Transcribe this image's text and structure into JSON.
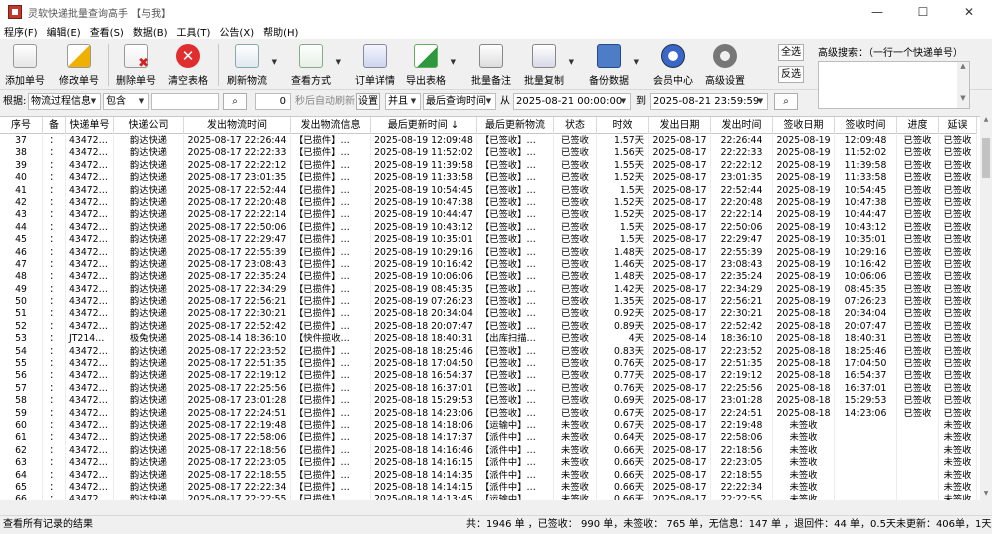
{
  "window": {
    "title": "灵软快递批量查询高手 【与我】",
    "minimize": "—",
    "maximize": "☐",
    "close": "✕"
  },
  "menu": [
    "程序(F)",
    "编辑(E)",
    "查看(S)",
    "数据(B)",
    "工具(T)",
    "公告(X)",
    "帮助(H)"
  ],
  "toolbar": {
    "add": "添加单号",
    "edit": "修改单号",
    "delete": "删除单号",
    "clear": "清空表格",
    "refresh": "刷新物流",
    "view_mode": "查看方式",
    "details": "订单详情",
    "export": "导出表格",
    "batch_note": "批量备注",
    "batch_copy": "批量复制",
    "backup": "备份数据",
    "member": "会员中心",
    "advanced_settings": "高级设置",
    "select_all": "全选",
    "invert": "反选",
    "advanced_search_label": "高级搜索：（一行一个快递单号）"
  },
  "filter": {
    "label": "根据:",
    "field": "物流过程信息",
    "match": "包含",
    "search_text": "",
    "count_value": "0",
    "auto_refresh": "秒后自动刷新",
    "settings": "设置",
    "logic": "并且",
    "time_field": "最后查询时间",
    "from_label": "从",
    "from_date": "2025-08-21 00:00:00",
    "to_label": "到",
    "to_date": "2025-08-21 23:59:59"
  },
  "grid": {
    "columns": [
      "序号",
      "备",
      "快递单号",
      "快递公司",
      "发出物流时间",
      "发出物流信息",
      "最后更新时间 ↓",
      "最后更新物流",
      "状态",
      "时效",
      "发出日期",
      "发出时间",
      "签收日期",
      "签收时间",
      "进度",
      "延误"
    ],
    "rows": [
      [
        "37",
        "：",
        "43472…",
        "韵达快递",
        "2025-08-17 22:26:44",
        "【已揽件】…",
        "2025-08-19 12:09:48",
        "【已签收】…",
        "已签收",
        "1.57天",
        "2025-08-17",
        "22:26:44",
        "2025-08-19",
        "12:09:48",
        "已签收",
        "已签收"
      ],
      [
        "38",
        "：",
        "43472…",
        "韵达快递",
        "2025-08-17 22:22:33",
        "【已揽件】…",
        "2025-08-19 11:52:02",
        "【已签收】…",
        "已签收",
        "1.56天",
        "2025-08-17",
        "22:22:33",
        "2025-08-19",
        "11:52:02",
        "已签收",
        "已签收"
      ],
      [
        "39",
        "：",
        "43472…",
        "韵达快递",
        "2025-08-17 22:22:12",
        "【已揽件】…",
        "2025-08-19 11:39:58",
        "【已签收】…",
        "已签收",
        "1.55天",
        "2025-08-17",
        "22:22:12",
        "2025-08-19",
        "11:39:58",
        "已签收",
        "已签收"
      ],
      [
        "40",
        "：",
        "43472…",
        "韵达快递",
        "2025-08-17 23:01:35",
        "【已揽件】…",
        "2025-08-19 11:33:58",
        "【已签收】…",
        "已签收",
        "1.52天",
        "2025-08-17",
        "23:01:35",
        "2025-08-19",
        "11:33:58",
        "已签收",
        "已签收"
      ],
      [
        "41",
        "：",
        "43472…",
        "韵达快递",
        "2025-08-17 22:52:44",
        "【已揽件】…",
        "2025-08-19 10:54:45",
        "【已签收】…",
        "已签收",
        "1.5天",
        "2025-08-17",
        "22:52:44",
        "2025-08-19",
        "10:54:45",
        "已签收",
        "已签收"
      ],
      [
        "42",
        "：",
        "43472…",
        "韵达快递",
        "2025-08-17 22:20:48",
        "【已揽件】…",
        "2025-08-19 10:47:38",
        "【已签收】…",
        "已签收",
        "1.52天",
        "2025-08-17",
        "22:20:48",
        "2025-08-19",
        "10:47:38",
        "已签收",
        "已签收"
      ],
      [
        "43",
        "：",
        "43472…",
        "韵达快递",
        "2025-08-17 22:22:14",
        "【已揽件】…",
        "2025-08-19 10:44:47",
        "【已签收】…",
        "已签收",
        "1.52天",
        "2025-08-17",
        "22:22:14",
        "2025-08-19",
        "10:44:47",
        "已签收",
        "已签收"
      ],
      [
        "44",
        "：",
        "43472…",
        "韵达快递",
        "2025-08-17 22:50:06",
        "【已揽件】…",
        "2025-08-19 10:43:12",
        "【已签收】…",
        "已签收",
        "1.5天",
        "2025-08-17",
        "22:50:06",
        "2025-08-19",
        "10:43:12",
        "已签收",
        "已签收"
      ],
      [
        "45",
        "：",
        "43472…",
        "韵达快递",
        "2025-08-17 22:29:47",
        "【已揽件】…",
        "2025-08-19 10:35:01",
        "【已签收】…",
        "已签收",
        "1.5天",
        "2025-08-17",
        "22:29:47",
        "2025-08-19",
        "10:35:01",
        "已签收",
        "已签收"
      ],
      [
        "46",
        "：",
        "43472…",
        "韵达快递",
        "2025-08-17 22:55:39",
        "【已揽件】…",
        "2025-08-19 10:29:16",
        "【已签收】…",
        "已签收",
        "1.48天",
        "2025-08-17",
        "22:55:39",
        "2025-08-19",
        "10:29:16",
        "已签收",
        "已签收"
      ],
      [
        "47",
        "：",
        "43472…",
        "韵达快递",
        "2025-08-17 23:08:43",
        "【已揽件】…",
        "2025-08-19 10:16:42",
        "【已签收】…",
        "已签收",
        "1.46天",
        "2025-08-17",
        "23:08:43",
        "2025-08-19",
        "10:16:42",
        "已签收",
        "已签收"
      ],
      [
        "48",
        "：",
        "43472…",
        "韵达快递",
        "2025-08-17 22:35:24",
        "【已揽件】…",
        "2025-08-19 10:06:06",
        "【已签收】…",
        "已签收",
        "1.48天",
        "2025-08-17",
        "22:35:24",
        "2025-08-19",
        "10:06:06",
        "已签收",
        "已签收"
      ],
      [
        "49",
        "：",
        "43472…",
        "韵达快递",
        "2025-08-17 22:34:29",
        "【已揽件】…",
        "2025-08-19 08:45:35",
        "【已签收】…",
        "已签收",
        "1.42天",
        "2025-08-17",
        "22:34:29",
        "2025-08-19",
        "08:45:35",
        "已签收",
        "已签收"
      ],
      [
        "50",
        "：",
        "43472…",
        "韵达快递",
        "2025-08-17 22:56:21",
        "【已揽件】…",
        "2025-08-19 07:26:23",
        "【已签收】…",
        "已签收",
        "1.35天",
        "2025-08-17",
        "22:56:21",
        "2025-08-19",
        "07:26:23",
        "已签收",
        "已签收"
      ],
      [
        "51",
        "：",
        "43472…",
        "韵达快递",
        "2025-08-17 22:30:21",
        "【已揽件】…",
        "2025-08-18 20:34:04",
        "【已签收】…",
        "已签收",
        "0.92天",
        "2025-08-17",
        "22:30:21",
        "2025-08-18",
        "20:34:04",
        "已签收",
        "已签收"
      ],
      [
        "52",
        "：",
        "43472…",
        "韵达快递",
        "2025-08-17 22:52:42",
        "【已揽件】…",
        "2025-08-18 20:07:47",
        "【已签收】…",
        "已签收",
        "0.89天",
        "2025-08-17",
        "22:52:42",
        "2025-08-18",
        "20:07:47",
        "已签收",
        "已签收"
      ],
      [
        "53",
        "：",
        "JT214…",
        "极兔快递",
        "2025-08-14 18:36:10",
        "【快件揽收…",
        "2025-08-18 18:40:31",
        "【出库扫描…",
        "已签收",
        "4天",
        "2025-08-14",
        "18:36:10",
        "2025-08-18",
        "18:40:31",
        "已签收",
        "已签收"
      ],
      [
        "54",
        "：",
        "43472…",
        "韵达快递",
        "2025-08-17 22:23:52",
        "【已揽件】…",
        "2025-08-18 18:25:46",
        "【已签收】…",
        "已签收",
        "0.83天",
        "2025-08-17",
        "22:23:52",
        "2025-08-18",
        "18:25:46",
        "已签收",
        "已签收"
      ],
      [
        "55",
        "：",
        "43472…",
        "韵达快递",
        "2025-08-17 22:51:35",
        "【已揽件】…",
        "2025-08-18 17:04:50",
        "【已签收】…",
        "已签收",
        "0.76天",
        "2025-08-17",
        "22:51:35",
        "2025-08-18",
        "17:04:50",
        "已签收",
        "已签收"
      ],
      [
        "56",
        "：",
        "43472…",
        "韵达快递",
        "2025-08-17 22:19:12",
        "【已揽件】…",
        "2025-08-18 16:54:37",
        "【已签收】…",
        "已签收",
        "0.77天",
        "2025-08-17",
        "22:19:12",
        "2025-08-18",
        "16:54:37",
        "已签收",
        "已签收"
      ],
      [
        "57",
        "：",
        "43472…",
        "韵达快递",
        "2025-08-17 22:25:56",
        "【已揽件】…",
        "2025-08-18 16:37:01",
        "【已签收】…",
        "已签收",
        "0.76天",
        "2025-08-17",
        "22:25:56",
        "2025-08-18",
        "16:37:01",
        "已签收",
        "已签收"
      ],
      [
        "58",
        "：",
        "43472…",
        "韵达快递",
        "2025-08-17 23:01:28",
        "【已揽件】…",
        "2025-08-18 15:29:53",
        "【已签收】…",
        "已签收",
        "0.69天",
        "2025-08-17",
        "23:01:28",
        "2025-08-18",
        "15:29:53",
        "已签收",
        "已签收"
      ],
      [
        "59",
        "：",
        "43472…",
        "韵达快递",
        "2025-08-17 22:24:51",
        "【已揽件】…",
        "2025-08-18 14:23:06",
        "【已签收】…",
        "已签收",
        "0.67天",
        "2025-08-17",
        "22:24:51",
        "2025-08-18",
        "14:23:06",
        "已签收",
        "已签收"
      ],
      [
        "60",
        "：",
        "43472…",
        "韵达快递",
        "2025-08-17 22:19:48",
        "【已揽件】…",
        "2025-08-18 14:18:06",
        "【运输中】…",
        "未签收",
        "0.67天",
        "2025-08-17",
        "22:19:48",
        "未签收",
        "",
        "",
        "未签收"
      ],
      [
        "61",
        "：",
        "43472…",
        "韵达快递",
        "2025-08-17 22:58:06",
        "【已揽件】…",
        "2025-08-18 14:17:37",
        "【派件中】…",
        "未签收",
        "0.64天",
        "2025-08-17",
        "22:58:06",
        "未签收",
        "",
        "",
        "未签收"
      ],
      [
        "62",
        "：",
        "43472…",
        "韵达快递",
        "2025-08-17 22:18:56",
        "【已揽件】…",
        "2025-08-18 14:16:46",
        "【派件中】…",
        "未签收",
        "0.66天",
        "2025-08-17",
        "22:18:56",
        "未签收",
        "",
        "",
        "未签收"
      ],
      [
        "63",
        "：",
        "43472…",
        "韵达快递",
        "2025-08-17 22:23:05",
        "【已揽件】…",
        "2025-08-18 14:16:15",
        "【派件中】…",
        "未签收",
        "0.66天",
        "2025-08-17",
        "22:23:05",
        "未签收",
        "",
        "",
        "未签收"
      ],
      [
        "64",
        "：",
        "43472…",
        "韵达快递",
        "2025-08-17 22:18:55",
        "【已揽件】…",
        "2025-08-18 14:14:35",
        "【派件中】…",
        "未签收",
        "0.66天",
        "2025-08-17",
        "22:18:55",
        "未签收",
        "",
        "",
        "未签收"
      ],
      [
        "65",
        "：",
        "43472…",
        "韵达快递",
        "2025-08-17 22:22:34",
        "【已揽件】…",
        "2025-08-18 14:14:15",
        "【派件中】…",
        "未签收",
        "0.66天",
        "2025-08-17",
        "22:22:34",
        "未签收",
        "",
        "",
        "未签收"
      ],
      [
        "66",
        "：",
        "43472…",
        "韵达快递",
        "2025-08-17 22:22:55",
        "【已揽件】…",
        "2025-08-18 14:13:45",
        "【运输中】…",
        "未签收",
        "0.66天",
        "2025-08-17",
        "22:22:55",
        "未签收",
        "",
        "",
        "未签收"
      ]
    ]
  },
  "status": {
    "left": "查看所有记录的结果",
    "right": "共：1946 单 ，已签收： 990 单，未签收： 765 单，无信息：147 单 ，退回件：44 单，0.5天未更新：406单，1天未更新："
  }
}
